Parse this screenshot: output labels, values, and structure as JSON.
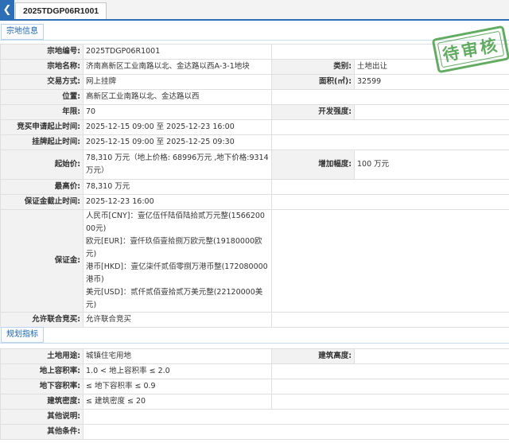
{
  "header": {
    "back_icon": "arrow-left-icon",
    "tab_title": "2025TDGP06R1001"
  },
  "sections": {
    "land_info": "宗地信息",
    "planning": "规划指标"
  },
  "stamp": {
    "text": "待审核",
    "color": "#52a452"
  },
  "colors": {
    "accent": "#2c6fb6",
    "label_bg": "#f2f2f2"
  },
  "land": {
    "parcel_no_label": "宗地编号:",
    "parcel_no": "2025TDGP06R1001",
    "parcel_name_label": "宗地名称:",
    "parcel_name": "济南高新区工业南路以北、金达路以西A-3-1地块",
    "category_label": "类别:",
    "category": "土地出让",
    "trade_method_label": "交易方式:",
    "trade_method": "网上挂牌",
    "area_label": "面积(㎡):",
    "area": "32599",
    "location_label": "位置:",
    "location": "高新区工业南路以北、金达路以西",
    "term_label": "年限:",
    "term": "70",
    "dev_intensity_label": "开发强度:",
    "dev_intensity": "",
    "apply_period_label": "竞买申请起止时间:",
    "apply_period": "2025-12-15 09:00 至 2025-12-23 16:00",
    "listing_period_label": "挂牌起止时间:",
    "listing_period": "2025-12-15 09:00 至 2025-12-25 09:30",
    "start_price_label": "起始价:",
    "start_price": "78,310 万元（地上价格: 68996万元 ,地下价格:9314万元）",
    "increment_label": "增加幅度:",
    "increment": "100 万元",
    "max_price_label": "最高价:",
    "max_price": "78,310 万元",
    "deposit_deadline_label": "保证金截止时间:",
    "deposit_deadline": "2025-12-23 16:00",
    "deposit_label": "保证金:",
    "deposit_cny": "人民币[CNY]：壹亿伍仟陆佰陆拾贰万元整(156620000元)",
    "deposit_eur": "欧元[EUR]：壹仟玖佰壹拾捌万欧元整(19180000欧元)",
    "deposit_hkd": "港币[HKD]：壹亿柒仟贰佰零捌万港币整(172080000港币)",
    "deposit_usd": "美元[USD]：贰仟贰佰壹拾贰万美元整(22120000美元)",
    "joint_bid_label": "允许联合竞买:",
    "joint_bid": "允许联合竞买"
  },
  "planning": {
    "land_use_label": "土地用途:",
    "land_use": "城镇住宅用地",
    "building_height_label": "建筑高度:",
    "building_height": "",
    "above_far_label": "地上容积率:",
    "above_far": "1.0 < 地上容积率 ≤ 2.0",
    "under_far_label": "地下容积率:",
    "under_far": "≤ 地下容积率 ≤ 0.9",
    "density_label": "建筑密度:",
    "density": "≤ 建筑密度 ≤ 20",
    "other_desc_label": "其他说明:",
    "other_desc": "",
    "other_cond_label": "其他条件:",
    "other_cond": ""
  }
}
